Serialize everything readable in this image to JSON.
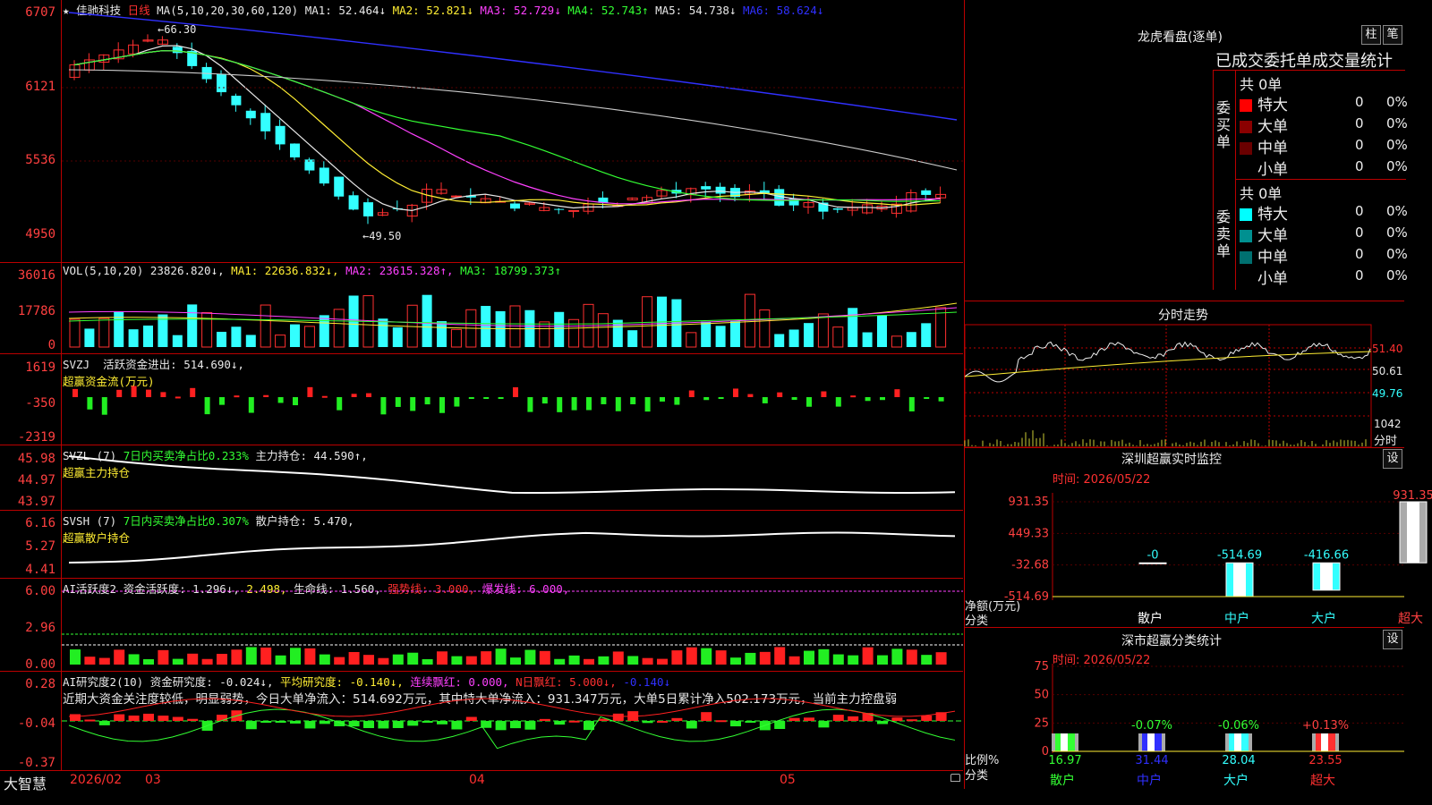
{
  "title": {
    "star": "★",
    "name": "佳驰科技",
    "period": "日线",
    "ma_params": "MA(5,10,20,30,60,120)"
  },
  "ma": [
    {
      "label": "MA1:",
      "value": "52.464↓",
      "color": "#e8e8e8"
    },
    {
      "label": "MA2:",
      "value": "52.821↓",
      "color": "#ffee33"
    },
    {
      "label": "MA3:",
      "value": "52.729↓",
      "color": "#ff40ff"
    },
    {
      "label": "MA4:",
      "value": "52.743↑",
      "color": "#33ff33"
    },
    {
      "label": "MA5:",
      "value": "54.738↓",
      "color": "#e8e8e8"
    },
    {
      "label": "MA6:",
      "value": "58.624↓",
      "color": "#3030ff"
    }
  ],
  "price_ticks": [
    "6707",
    "6121",
    "5536",
    "4950"
  ],
  "price_marks": {
    "high": "66.30",
    "low": "49.50"
  },
  "vol": {
    "params": "VOL(5,10,20)",
    "value": "23826.820↓,",
    "ma1": "MA1: 22636.832↓,",
    "ma2": "MA2: 23615.328↑,",
    "ma3": "MA3: 18799.373↑",
    "ticks": [
      "36016",
      "17786",
      "0"
    ]
  },
  "svzj": {
    "name": "SVZJ",
    "label": "活跃资金进出: 514.690↓,",
    "sub": "超赢资金流(万元)",
    "ticks": [
      "1619",
      "-350",
      "-2319"
    ]
  },
  "svzl": {
    "name": "SVZL (7)",
    "ratio": "7日内买卖净占比0.233%",
    "label": "主力持仓: 44.590↑,",
    "sub": "超赢主力持仓",
    "ticks": [
      "45.98",
      "44.97",
      "43.97"
    ]
  },
  "svsh": {
    "name": "SVSH (7)",
    "ratio": "7日内买卖净占比0.307%",
    "label": "散户持仓: 5.470,",
    "sub": "超赢散户持仓",
    "ticks": [
      "6.16",
      "5.27",
      "4.41"
    ]
  },
  "ai1": {
    "name": "AI活跃度2",
    "active": "资金活跃度: 1.296↓,",
    "v2": "2.498,",
    "life": "生命线: 1.560,",
    "strong": "强势线: 3.000,",
    "burst": "爆发线: 6.000,",
    "ticks": [
      "6.00",
      "2.96",
      "0.00"
    ]
  },
  "ai2": {
    "name": "AI研究度2(10)",
    "research": "资金研究度: -0.024↓,",
    "avg": "平均研究度: -0.140↓,",
    "cont": "连续飘红: 0.000,",
    "nday": "N日飘红: 5.000↓,",
    "last": "-0.140↓",
    "text": "近期大资金关注度较低，明显弱势，今日大单净流入：514.692万元，其中特大单净流入：931.347万元，大单5日累计净入502.173万元，当前主力控盘弱",
    "ticks": [
      "0.28",
      "-0.04",
      "-0.37"
    ]
  },
  "xaxis": {
    "brand": "大智慧",
    "labels": [
      "2026/02",
      "03",
      "04",
      "05"
    ]
  },
  "dragon": {
    "title": "龙虎看盘(逐单)",
    "btn1": "柱",
    "btn2": "笔",
    "header": "已成交委托单成交量统计"
  },
  "buy": {
    "side": "委买单",
    "total": "共 0单",
    "rows": [
      {
        "label": "特大",
        "n": "0",
        "p": "0%",
        "color": "#ff0000"
      },
      {
        "label": "大单",
        "n": "0",
        "p": "0%",
        "color": "#8a0000"
      },
      {
        "label": "中单",
        "n": "0",
        "p": "0%",
        "color": "#6a0000"
      },
      {
        "label": "小单",
        "n": "0",
        "p": "0%",
        "color": "#000000"
      }
    ]
  },
  "sell": {
    "side": "委卖单",
    "total": "共 0单",
    "rows": [
      {
        "label": "特大",
        "n": "0",
        "p": "0%",
        "color": "#00ffff"
      },
      {
        "label": "大单",
        "n": "0",
        "p": "0%",
        "color": "#009090"
      },
      {
        "label": "中单",
        "n": "0",
        "p": "0%",
        "color": "#007070"
      },
      {
        "label": "小单",
        "n": "0",
        "p": "0%",
        "color": "#000000"
      }
    ]
  },
  "intraday": {
    "title": "分时走势",
    "ticks": [
      "51.40",
      "50.61",
      "49.76"
    ],
    "vol": "1042",
    "unit": "分时"
  },
  "sz_monitor": {
    "title": "深圳超赢实时监控",
    "btn": "设",
    "time": "时间: 2026/05/22",
    "unit": "净额(万元)",
    "cat": "分类",
    "ticks": [
      "931.35",
      "449.33",
      "-32.68",
      "-514.69"
    ]
  },
  "sz_class": {
    "title": "深市超赢分类统计",
    "btn": "设",
    "time": "时间: 2026/05/22",
    "unit": "比例%",
    "cat": "分类",
    "ticks": [
      "75",
      "50",
      "25",
      "0"
    ]
  },
  "chart_data": [
    {
      "type": "bar",
      "title": "深圳超赢实时监控",
      "categories": [
        "散户",
        "中户",
        "大户",
        "超大"
      ],
      "values": [
        0,
        -514.69,
        -416.66,
        931.35
      ],
      "labels": [
        "-0",
        "-514.69",
        "-416.66",
        "931.35"
      ],
      "ylabel": "净额(万元)",
      "xlabel": "分类",
      "ylim": [
        -514.69,
        931.35
      ]
    },
    {
      "type": "bar",
      "title": "深市超赢分类统计",
      "categories": [
        "散户",
        "中户",
        "大户",
        "超大"
      ],
      "values": [
        16.97,
        31.44,
        28.04,
        23.55
      ],
      "changes": [
        "",
        "-0.07%",
        "-0.06%",
        "+0.13%"
      ],
      "value_labels": [
        "16.97",
        "31.44",
        "28.04",
        "23.55"
      ],
      "colors": [
        "#33ff33",
        "#3030ff",
        "#33ffff",
        "#ff3030"
      ],
      "ylabel": "比例%",
      "xlabel": "分类",
      "ylim": [
        0,
        75
      ]
    }
  ]
}
